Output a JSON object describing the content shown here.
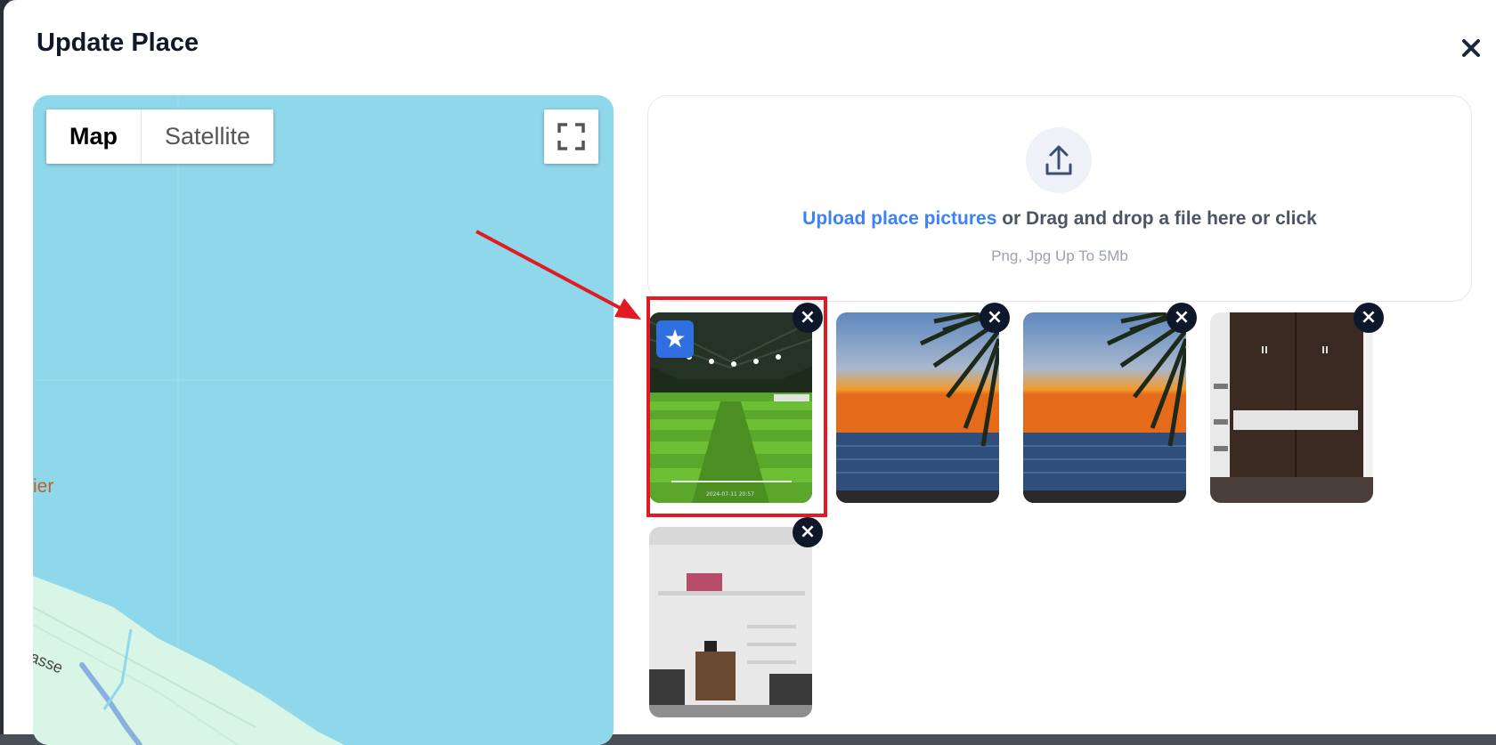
{
  "dialog": {
    "title": "Update Place",
    "close_icon": "close-icon"
  },
  "map": {
    "type_control": {
      "map_label": "Map",
      "satellite_label": "Satellite",
      "selected": "Map"
    },
    "fullscreen_icon": "fullscreen-icon",
    "labels": [
      "ier",
      "asse"
    ],
    "colors": {
      "water": "#8fd8eb",
      "land": "#d9f5e5"
    }
  },
  "upload": {
    "icon": "upload-icon",
    "link_text": "Upload place pictures",
    "instruction": " or Drag and drop a file here or click",
    "hint": "Png, Jpg Up To 5Mb"
  },
  "gallery": {
    "cover_badge_icon": "star-icon",
    "remove_icon": "close-icon",
    "images": [
      {
        "name": "cricket-turf",
        "is_cover": true,
        "highlighted": true,
        "caption": "2024-07-11 20:57"
      },
      {
        "name": "sunset-beach-palm",
        "is_cover": false
      },
      {
        "name": "sunset-beach-palm",
        "is_cover": false
      },
      {
        "name": "wooden-wardrobe",
        "is_cover": false
      },
      {
        "name": "room-interior",
        "is_cover": false
      }
    ]
  },
  "annotation": {
    "color": "#e01b24"
  }
}
